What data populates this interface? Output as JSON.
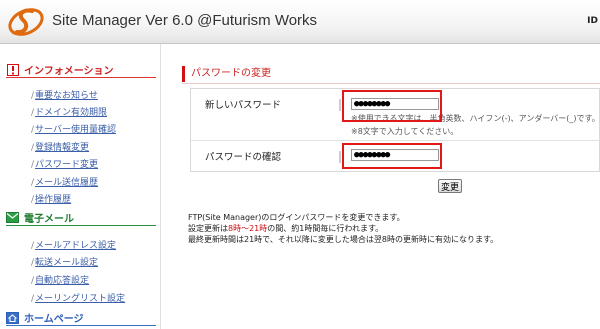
{
  "header": {
    "title": "Site Manager Ver 6.0 @Futurism Works",
    "id_label": "ID"
  },
  "sidebar": {
    "sections": [
      {
        "label": "インフォメーション",
        "icon": "exclamation-icon",
        "color": "#cc2222"
      },
      {
        "label": "電子メール",
        "icon": "mail-icon",
        "color": "#1e7c32"
      },
      {
        "label": "ホームページ",
        "icon": "home-icon",
        "color": "#2e5fb8"
      }
    ],
    "info_items": [
      "重要なお知らせ",
      "ドメイン有効期限",
      "サーバー使用量確認",
      "登録情報変更",
      "パスワード変更",
      "メール送信履歴",
      "操作履歴"
    ],
    "mail_items": [
      "メールアドレス設定",
      "転送メール設定",
      "自動応答設定",
      "メーリングリスト設定"
    ]
  },
  "main": {
    "page_title": "パスワードの変更",
    "new_password_label": "新しいパスワード",
    "new_password_value": "●●●●●●●●",
    "hint_chars": "※使用できる文字は、半角英数、ハイフン(-)、アンダーバー(_)です。",
    "hint_length": "※8文字で入力してください。",
    "confirm_password_label": "パスワードの確認",
    "confirm_password_value": "●●●●●●●●",
    "submit_label": "変更",
    "desc_line1": "FTP(Site Manager)のログインパスワードを変更できます。",
    "desc_line2_prefix": "設定更新は",
    "desc_line2_highlight": "8時～21時",
    "desc_line2_suffix": "の間、約1時間毎に行われます。",
    "desc_line3": "最終更新時間は21時で、それ以降に変更した場合は翌8時の更新時に有効になります。"
  },
  "colors": {
    "accent_red": "#d01010",
    "link_blue": "#3b5ea8"
  }
}
